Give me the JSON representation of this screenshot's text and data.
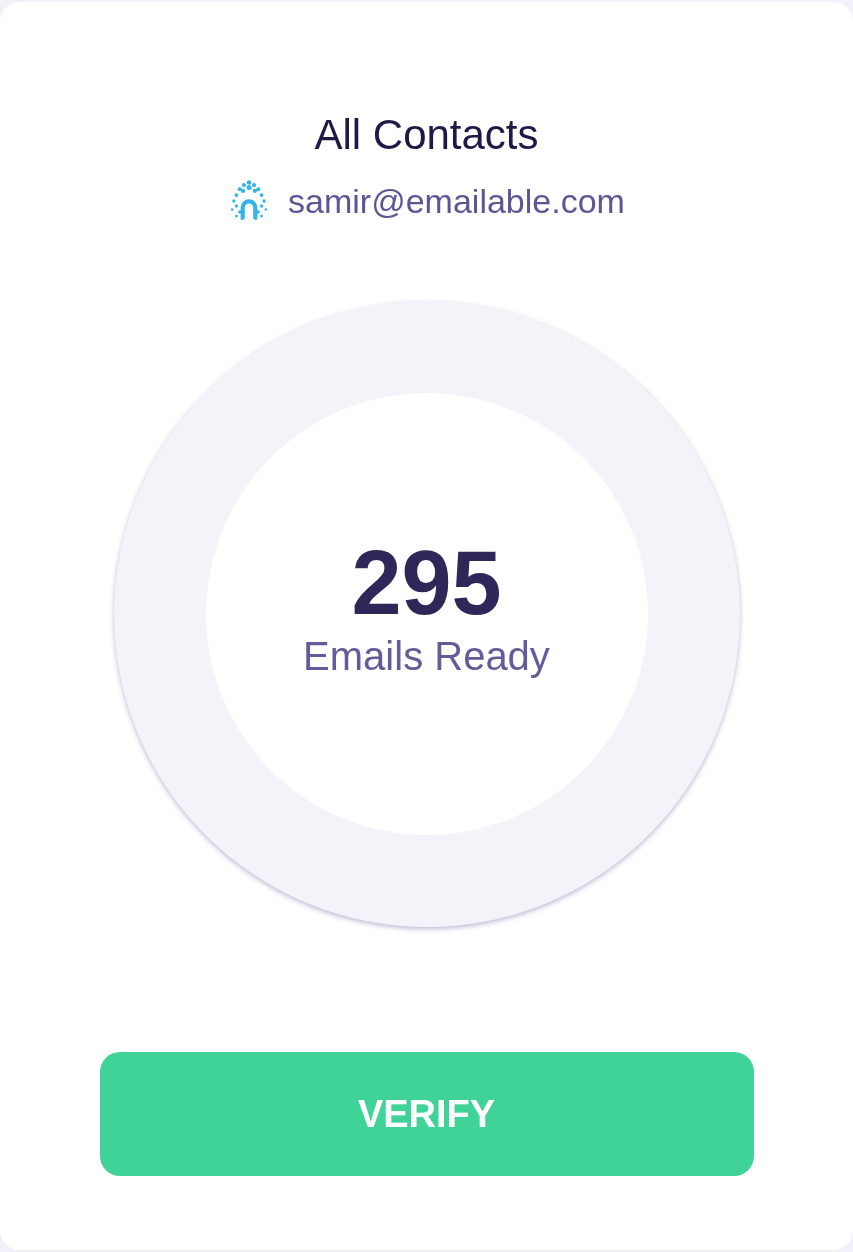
{
  "card": {
    "title": "All Contacts",
    "account": {
      "email": "samir@emailable.com"
    }
  },
  "counter": {
    "value": "295",
    "label": "Emails Ready"
  },
  "button": {
    "label": "VERIFY"
  }
}
